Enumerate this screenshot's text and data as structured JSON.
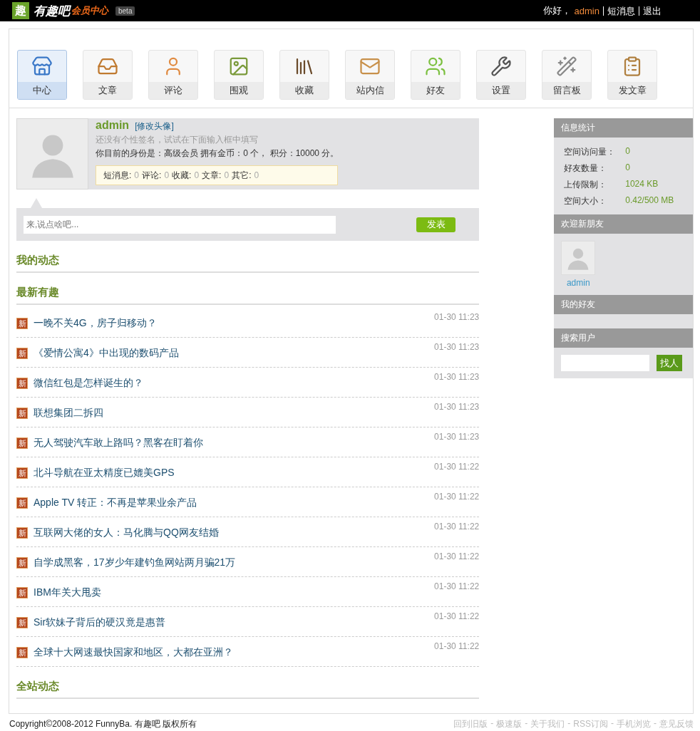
{
  "top_bar": {
    "logo_mark": "趣",
    "logo_name": "有趣吧",
    "logo_sub": "会员中心",
    "badge": "beta",
    "greeting": "你好，",
    "user": "admin",
    "links": [
      "短消息",
      "退出"
    ]
  },
  "nav": [
    {
      "label": "中心",
      "selected": true
    },
    {
      "label": "文章",
      "selected": false
    },
    {
      "label": "评论",
      "selected": false
    },
    {
      "label": "围观",
      "selected": false
    },
    {
      "label": "收藏",
      "selected": false
    },
    {
      "label": "站内信",
      "selected": false
    },
    {
      "label": "好友",
      "selected": false
    },
    {
      "label": "设置",
      "selected": false
    },
    {
      "label": "留言板",
      "selected": false
    },
    {
      "label": "发文章",
      "selected": false
    }
  ],
  "profile": {
    "name": "admin",
    "edit_avatar": "[修改头像]",
    "signature": "还没有个性签名，试试在下面输入框中填写",
    "status": "你目前的身份是：高级会员 拥有金币：0 个， 积分：10000 分。",
    "counts": [
      {
        "label": "短消息:",
        "value": "0"
      },
      {
        "label": "评论:",
        "value": "0"
      },
      {
        "label": "收藏:",
        "value": "0"
      },
      {
        "label": "文章:",
        "value": "0"
      },
      {
        "label": "其它:",
        "value": "0"
      }
    ]
  },
  "post_box": {
    "placeholder": "来,说点啥吧...",
    "button": "发表"
  },
  "sections": [
    {
      "title": "我的动态"
    },
    {
      "title": "最新有趣"
    }
  ],
  "articles": [
    {
      "badge": "新",
      "title": "一晚不关4G，房子归移动？",
      "time": "01-30 11:23"
    },
    {
      "badge": "新",
      "title": "《爱情公寓4》中出现的数码产品",
      "time": "01-30 11:23"
    },
    {
      "badge": "新",
      "title": "微信红包是怎样诞生的？",
      "time": "01-30 11:23"
    },
    {
      "badge": "新",
      "title": "联想集团二拆四",
      "time": "01-30 11:23"
    },
    {
      "badge": "新",
      "title": "无人驾驶汽车敢上路吗？黑客在盯着你",
      "time": "01-30 11:23"
    },
    {
      "badge": "新",
      "title": "北斗导航在亚太精度已媲美GPS",
      "time": "01-30 11:22"
    },
    {
      "badge": "新",
      "title": "Apple TV 转正：不再是苹果业余产品",
      "time": "01-30 11:22"
    },
    {
      "badge": "新",
      "title": "互联网大佬的女人：马化腾与QQ网友结婚",
      "time": "01-30 11:22"
    },
    {
      "badge": "新",
      "title": "自学成黑客，17岁少年建钓鱼网站两月骗21万",
      "time": "01-30 11:22"
    },
    {
      "badge": "新",
      "title": "IBM年关大甩卖",
      "time": "01-30 11:22"
    },
    {
      "badge": "新",
      "title": "Sir软妹子背后的硬汉竟是惠普",
      "time": "01-30 11:22"
    },
    {
      "badge": "新",
      "title": "全球十大网速最快国家和地区，大都在亚洲？",
      "time": "01-30 11:22"
    }
  ],
  "bottom_section": {
    "title": "全站动态"
  },
  "sidebar": {
    "stats_title": "信息统计",
    "stats": [
      {
        "label": "空间访问量：",
        "value": "0"
      },
      {
        "label": "好友数量：",
        "value": "0"
      },
      {
        "label": "上传限制：",
        "value": "1024 KB"
      },
      {
        "label": "空间大小：",
        "value": "0.42/500 MB"
      }
    ],
    "welcome_title": "欢迎新朋友",
    "new_friends": [
      {
        "name": "admin"
      }
    ],
    "friends_title": "我的好友",
    "search_title": "搜索用户",
    "search_button": "找人"
  },
  "footer": {
    "copyright": "Copyright©2008-2012 FunnyBa. 有趣吧 版权所有",
    "links": [
      "回到旧版",
      "极速版",
      "关于我们",
      "RSS订阅",
      "手机浏览",
      "意见反馈"
    ],
    "separator": "-"
  }
}
